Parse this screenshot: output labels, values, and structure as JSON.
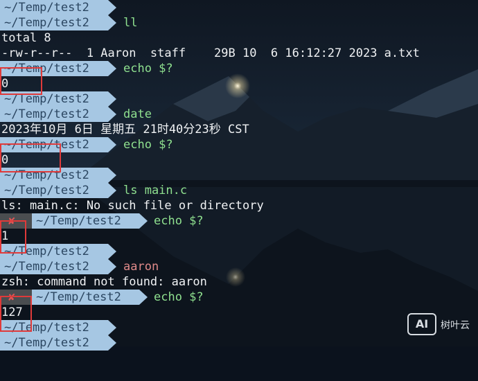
{
  "prompt": {
    "path": "~/Temp/test2",
    "error_mark": "✘"
  },
  "terminal": {
    "l01": {
      "cmd": ""
    },
    "l02": {
      "cmd": "ll"
    },
    "l03": {
      "text": "total 8"
    },
    "l04": {
      "text": "-rw-r--r--  1 Aaron  staff    29B 10  6 16:12:27 2023 a.txt"
    },
    "l05": {
      "cmd": "echo $?"
    },
    "l06": {
      "text": "0"
    },
    "l07": {
      "cmd": ""
    },
    "l08": {
      "cmd": "date"
    },
    "l09": {
      "text": "2023年10月 6日 星期五 21时40分23秒 CST"
    },
    "l10": {
      "cmd": "echo $?"
    },
    "l11": {
      "text": "0"
    },
    "l12": {
      "cmd": ""
    },
    "l13": {
      "cmd": "ls main.c"
    },
    "l14": {
      "text": "ls: main.c: No such file or directory"
    },
    "l15": {
      "cmd": "echo $?"
    },
    "l16": {
      "text": "1"
    },
    "l17": {
      "cmd": ""
    },
    "l18": {
      "cmd": "aaron"
    },
    "l19": {
      "text": "zsh: command not found: aaron"
    },
    "l20": {
      "cmd": "echo $?"
    },
    "l21": {
      "text": "127"
    },
    "l22": {
      "cmd": ""
    },
    "l23": {
      "cmd": ""
    }
  },
  "watermark": {
    "logo": "AI",
    "name": "树叶云"
  },
  "colors": {
    "prompt_bg": "#a6c7e3",
    "prompt_fg": "#2b4661",
    "command": "#8fe08f",
    "error": "#e05555",
    "highlight": "#e03a3a"
  }
}
